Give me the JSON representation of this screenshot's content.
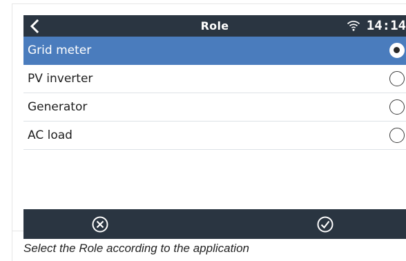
{
  "header": {
    "title": "Role",
    "time": "14:14",
    "back_icon": "chevron-left-icon",
    "wifi_icon": "wifi-icon"
  },
  "roles": {
    "items": [
      {
        "label": "Grid meter",
        "selected": true
      },
      {
        "label": "PV inverter",
        "selected": false
      },
      {
        "label": "Generator",
        "selected": false
      },
      {
        "label": "AC load",
        "selected": false
      }
    ]
  },
  "footer": {
    "cancel_icon": "circle-x-icon",
    "confirm_icon": "circle-check-icon"
  },
  "caption": "Select the Role according to the application",
  "colors": {
    "bar_background": "#2a3541",
    "selected_row": "#4a7cbd",
    "text": "#1d1d1d"
  }
}
